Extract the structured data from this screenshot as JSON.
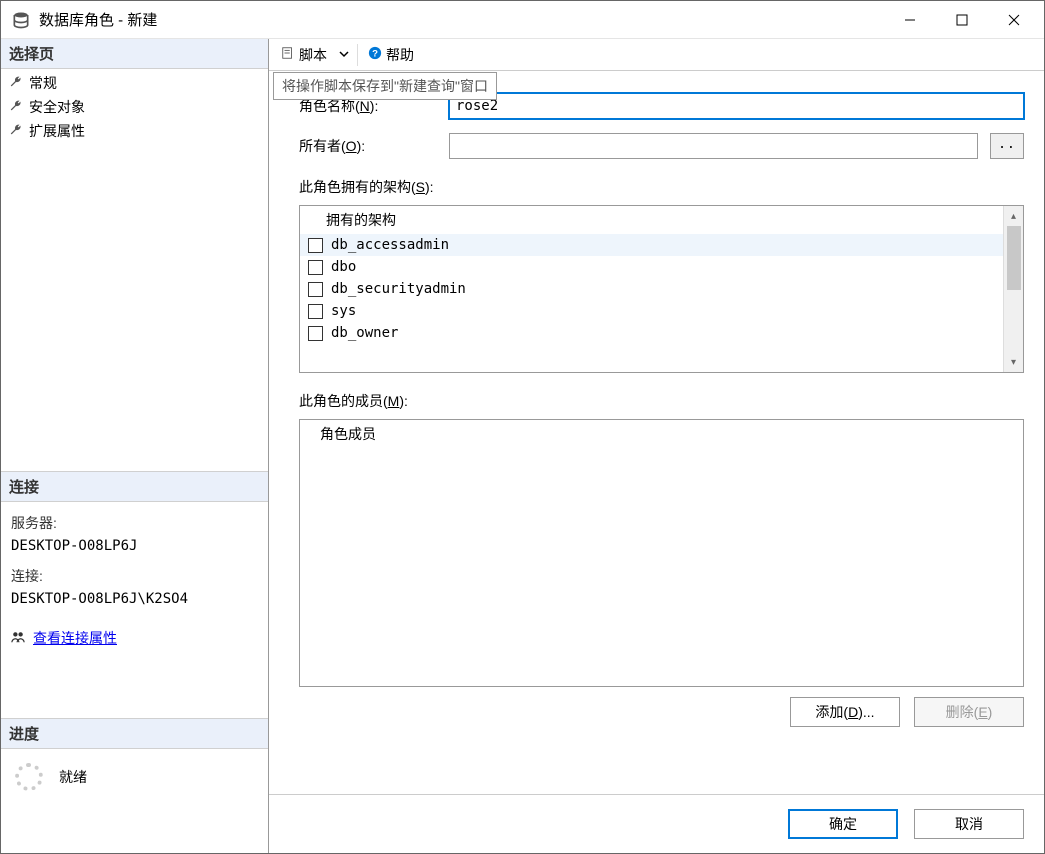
{
  "window": {
    "title": "数据库角色 - 新建"
  },
  "sidebar": {
    "select_page_header": "选择页",
    "pages": [
      {
        "label": "常规"
      },
      {
        "label": "安全对象"
      },
      {
        "label": "扩展属性"
      }
    ],
    "connection_header": "连接",
    "connection": {
      "server_label": "服务器:",
      "server_value": "DESKTOP-O08LP6J",
      "conn_label": "连接:",
      "conn_value": "DESKTOP-O08LP6J\\K2SO4",
      "view_props_link": "查看连接属性"
    },
    "progress_header": "进度",
    "progress_status": "就绪"
  },
  "toolbar": {
    "script_label": "脚本",
    "help_label": "帮助",
    "tooltip": "将操作脚本保存到\"新建查询\"窗口"
  },
  "form": {
    "role_name_label": "角色名称(",
    "role_name_accel": "N",
    "role_name_label_end": "):",
    "role_name_value": "rose2",
    "owner_label": "所有者(",
    "owner_accel": "O",
    "owner_label_end": "):",
    "owner_value": "",
    "owner_browse": "..",
    "schemas_label": "此角色拥有的架构(",
    "schemas_accel": "S",
    "schemas_label_end": "):",
    "schemas_header": "拥有的架构",
    "schemas": [
      {
        "name": "db_accessadmin",
        "checked": false,
        "hover": true
      },
      {
        "name": "dbo",
        "checked": false,
        "hover": false
      },
      {
        "name": "db_securityadmin",
        "checked": false,
        "hover": false
      },
      {
        "name": "sys",
        "checked": false,
        "hover": false
      },
      {
        "name": "db_owner",
        "checked": false,
        "hover": false
      }
    ],
    "members_label": "此角色的成员(",
    "members_accel": "M",
    "members_label_end": "):",
    "members_header": "角色成员",
    "add_btn": "添加(",
    "add_accel": "D",
    "add_btn_end": ")...",
    "remove_btn": "删除(",
    "remove_accel": "E",
    "remove_btn_end": ")"
  },
  "footer": {
    "ok": "确定",
    "cancel": "取消"
  }
}
